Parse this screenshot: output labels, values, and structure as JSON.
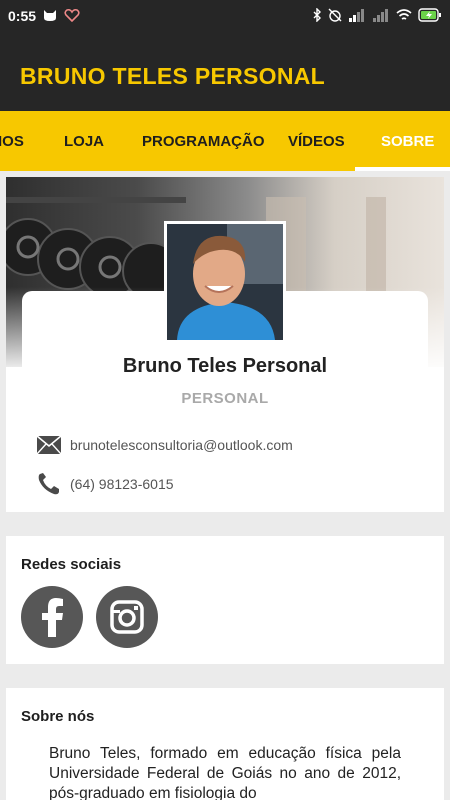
{
  "status_bar": {
    "time": "0:55"
  },
  "app_bar": {
    "title": "BRUNO TELES PERSONAL"
  },
  "tabs": [
    {
      "label": "IOS"
    },
    {
      "label": "LOJA"
    },
    {
      "label": "PROGRAMAÇÃO"
    },
    {
      "label": "VÍDEOS"
    },
    {
      "label": "SOBRE",
      "active": true
    }
  ],
  "profile": {
    "name": "Bruno Teles Personal",
    "role": "PERSONAL",
    "email": "brunotelesconsultoria@outlook.com",
    "phone": "(64) 98123-6015"
  },
  "social": {
    "title": "Redes sociais",
    "networks": [
      {
        "icon": "facebook-icon"
      },
      {
        "icon": "instagram-icon"
      }
    ]
  },
  "about": {
    "title": "Sobre nós",
    "text": "Bruno Teles, formado em educação física pela Universidade Federal de Goiás no ano de 2012, pós-graduado em fisiologia do"
  },
  "colors": {
    "accent": "#f7c800",
    "dark": "#262626",
    "icon_gray": "#575757"
  }
}
